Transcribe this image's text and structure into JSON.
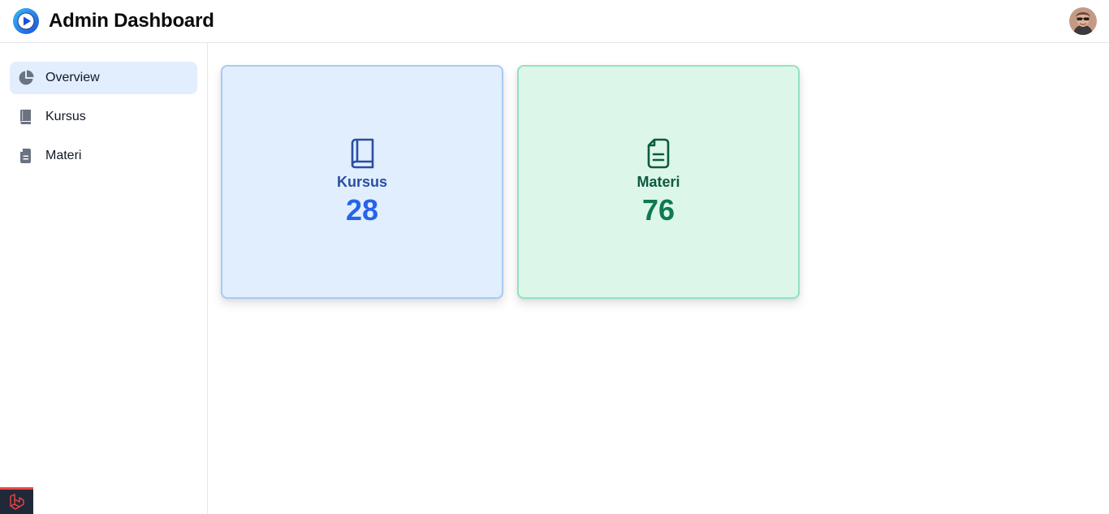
{
  "header": {
    "title": "Admin Dashboard",
    "logo_icon": "play-circle-icon",
    "avatar_icon": "user-avatar"
  },
  "sidebar": {
    "items": [
      {
        "label": "Overview",
        "icon": "pie-chart-icon",
        "active": true
      },
      {
        "label": "Kursus",
        "icon": "book-icon",
        "active": false
      },
      {
        "label": "Materi",
        "icon": "document-icon",
        "active": false
      }
    ]
  },
  "cards": [
    {
      "label": "Kursus",
      "value": "28",
      "icon": "book-icon",
      "accent": "#2563eb",
      "background": "#e1eefd",
      "border": "#a8caf3"
    },
    {
      "label": "Materi",
      "value": "76",
      "icon": "document-icon",
      "accent": "#0e7a4f",
      "background": "#dcf6ea",
      "border": "#93e2be"
    }
  ],
  "colors": {
    "active_nav_bg": "#e2eefd",
    "logo_blue": "#1d4ed8",
    "badge_red": "#ef4444"
  },
  "footer_badge": {
    "icon": "laravel-icon"
  }
}
